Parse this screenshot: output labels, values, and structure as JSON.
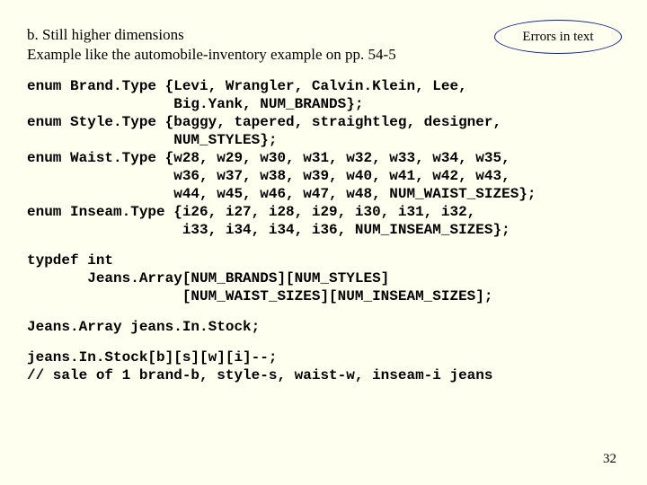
{
  "callout": "Errors in text",
  "heading": {
    "line1": "b. Still higher dimensions",
    "line2": "Example like the automobile-inventory example on pp. 54-5"
  },
  "code": {
    "enums": "enum Brand.Type {Levi, Wrangler, Calvin.Klein, Lee,\n                 Big.Yank, NUM_BRANDS};\nenum Style.Type {baggy, tapered, straightleg, designer,\n                 NUM_STYLES};\nenum Waist.Type {w28, w29, w30, w31, w32, w33, w34, w35,\n                 w36, w37, w38, w39, w40, w41, w42, w43,\n                 w44, w45, w46, w47, w48, NUM_WAIST_SIZES};\nenum Inseam.Type {i26, i27, i28, i29, i30, i31, i32,\n                  i33, i34, i34, i36, NUM_INSEAM_SIZES};",
    "typedef": "typdef int\n       Jeans.Array[NUM_BRANDS][NUM_STYLES]\n                  [NUM_WAIST_SIZES][NUM_INSEAM_SIZES];",
    "decl": "Jeans.Array jeans.In.Stock;",
    "usage": "jeans.In.Stock[b][s][w][i]--;\n// sale of 1 brand-b, style-s, waist-w, inseam-i jeans"
  },
  "pageNumber": "32"
}
